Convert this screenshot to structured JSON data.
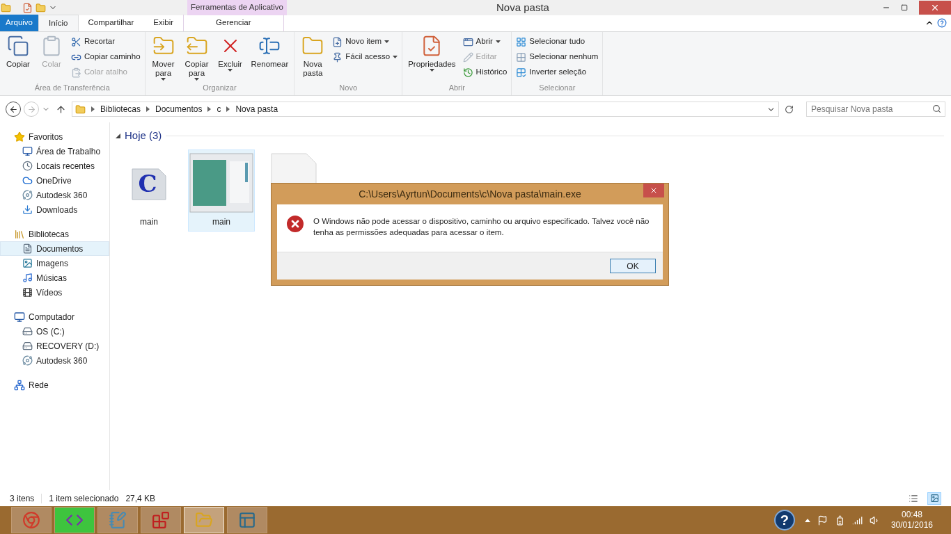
{
  "window": {
    "title": "Nova pasta",
    "context_group": "Ferramentas de Aplicativo"
  },
  "tabs": [
    {
      "label": "Arquivo",
      "kind": "file",
      "selected": false
    },
    {
      "label": "Início",
      "kind": "normal",
      "selected": true
    },
    {
      "label": "Compartilhar",
      "kind": "normal",
      "selected": false
    },
    {
      "label": "Exibir",
      "kind": "normal",
      "selected": false
    },
    {
      "label": "Gerenciar",
      "kind": "contextual",
      "selected": false
    }
  ],
  "ribbon": [
    {
      "label": "Área de Transferência",
      "items": [
        {
          "label": "Copiar",
          "kind": "large",
          "disabled": false,
          "dropdown": false
        },
        {
          "label": "Colar",
          "kind": "large",
          "disabled": true,
          "dropdown": false
        },
        {
          "label": "Recortar",
          "kind": "small",
          "disabled": false,
          "dropdown": false
        },
        {
          "label": "Copiar caminho",
          "kind": "small",
          "disabled": false,
          "dropdown": false
        },
        {
          "label": "Colar atalho",
          "kind": "small",
          "disabled": true,
          "dropdown": false
        }
      ]
    },
    {
      "label": "Organizar",
      "items": [
        {
          "label": "Mover para",
          "kind": "large",
          "disabled": false,
          "dropdown": true
        },
        {
          "label": "Copiar para",
          "kind": "large",
          "disabled": false,
          "dropdown": true
        },
        {
          "label": "Excluir",
          "kind": "large",
          "disabled": false,
          "dropdown": true
        },
        {
          "label": "Renomear",
          "kind": "large",
          "disabled": false,
          "dropdown": false
        }
      ]
    },
    {
      "label": "Novo",
      "items": [
        {
          "label": "Nova pasta",
          "kind": "large",
          "disabled": false,
          "dropdown": false
        },
        {
          "label": "Novo item",
          "kind": "small",
          "disabled": false,
          "dropdown": true
        },
        {
          "label": "Fácil acesso",
          "kind": "small",
          "disabled": false,
          "dropdown": true
        }
      ]
    },
    {
      "label": "Abrir",
      "items": [
        {
          "label": "Propriedades",
          "kind": "large",
          "disabled": false,
          "dropdown": true
        },
        {
          "label": "Abrir",
          "kind": "small",
          "disabled": false,
          "dropdown": true
        },
        {
          "label": "Editar",
          "kind": "small",
          "disabled": true,
          "dropdown": false
        },
        {
          "label": "Histórico",
          "kind": "small",
          "disabled": false,
          "dropdown": false
        }
      ]
    },
    {
      "label": "Selecionar",
      "items": [
        {
          "label": "Selecionar tudo",
          "kind": "small",
          "disabled": false,
          "dropdown": false
        },
        {
          "label": "Selecionar nenhum",
          "kind": "small",
          "disabled": false,
          "dropdown": false
        },
        {
          "label": "Inverter seleção",
          "kind": "small",
          "disabled": false,
          "dropdown": false
        }
      ]
    }
  ],
  "address": {
    "back_disabled": false,
    "forward_disabled": true,
    "path": [
      "Bibliotecas",
      "Documentos",
      "c",
      "Nova pasta"
    ],
    "search_placeholder": "Pesquisar Nova pasta"
  },
  "sidebar": [
    {
      "label": "Favoritos",
      "children": [
        {
          "label": "Área de Trabalho",
          "selected": false
        },
        {
          "label": "Locais recentes",
          "selected": false
        },
        {
          "label": "OneDrive",
          "selected": false
        },
        {
          "label": "Autodesk 360",
          "selected": false
        },
        {
          "label": "Downloads",
          "selected": false
        }
      ]
    },
    {
      "label": "Bibliotecas",
      "children": [
        {
          "label": "Documentos",
          "selected": true
        },
        {
          "label": "Imagens",
          "selected": false
        },
        {
          "label": "Músicas",
          "selected": false
        },
        {
          "label": "Vídeos",
          "selected": false
        }
      ]
    },
    {
      "label": "Computador",
      "children": [
        {
          "label": "OS (C:)",
          "selected": false
        },
        {
          "label": "RECOVERY (D:)",
          "selected": false
        },
        {
          "label": "Autodesk 360",
          "selected": false
        }
      ]
    },
    {
      "label": "Rede"
    }
  ],
  "group": {
    "label": "Hoje (3)",
    "expanded": true
  },
  "files": [
    {
      "kind": "c-source",
      "icon_text": "C",
      "name": "main",
      "selected": false
    },
    {
      "kind": "program",
      "name": "main",
      "selected": true
    },
    {
      "kind": "blank",
      "selected": false
    }
  ],
  "status": {
    "count": "3 itens",
    "selection": "1 item selecionado",
    "size": "27,4 KB",
    "views": [
      {
        "kind": "details",
        "selected": false
      },
      {
        "kind": "large-icons",
        "selected": true
      }
    ]
  },
  "dialog": {
    "title": "C:\\Users\\Ayrtun\\Documents\\c\\Nova pasta\\main.exe",
    "message": "O Windows não pode acessar o dispositivo, caminho ou arquivo especificado. Talvez você não tenha as permissões adequadas para acessar o item.",
    "button": "OK"
  },
  "taskbar": {
    "apps": [
      {
        "kind": "browser",
        "selected": false,
        "highlighted": false
      },
      {
        "kind": "ide",
        "selected": false,
        "highlighted": true
      },
      {
        "kind": "notepad",
        "selected": false,
        "highlighted": false
      },
      {
        "kind": "blocks",
        "selected": false,
        "highlighted": false
      },
      {
        "kind": "explorer",
        "selected": true,
        "highlighted": false
      },
      {
        "kind": "window",
        "selected": false,
        "highlighted": false
      }
    ],
    "help": "?",
    "time": "00:48",
    "date": "30/01/2016"
  }
}
